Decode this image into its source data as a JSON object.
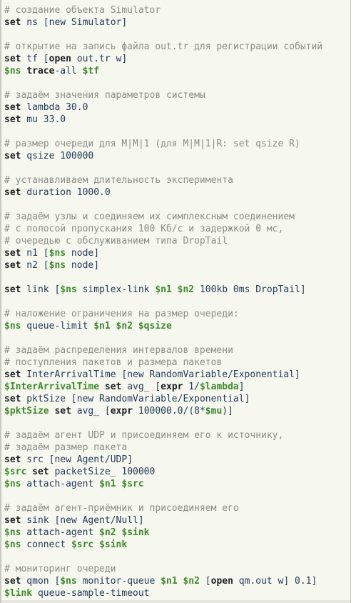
{
  "editor": {
    "lines": [
      [
        {
          "t": "c",
          "v": "# создание объекта Simulator"
        }
      ],
      [
        {
          "t": "k",
          "v": "set"
        },
        {
          "t": "x",
          "v": " ns [new Simulator]"
        }
      ],
      [],
      [
        {
          "t": "c",
          "v": "# открытие на запись файла out.tr для регистрации событий"
        }
      ],
      [
        {
          "t": "k",
          "v": "set"
        },
        {
          "t": "x",
          "v": " tf ["
        },
        {
          "t": "k",
          "v": "open"
        },
        {
          "t": "x",
          "v": " out.tr w]"
        }
      ],
      [
        {
          "t": "v",
          "v": "$ns"
        },
        {
          "t": "x",
          "v": " "
        },
        {
          "t": "k",
          "v": "trace"
        },
        {
          "t": "x",
          "v": "-all "
        },
        {
          "t": "v",
          "v": "$tf"
        }
      ],
      [],
      [
        {
          "t": "c",
          "v": "# задаём значения параметров системы"
        }
      ],
      [
        {
          "t": "k",
          "v": "set"
        },
        {
          "t": "x",
          "v": " lambda 30.0"
        }
      ],
      [
        {
          "t": "k",
          "v": "set"
        },
        {
          "t": "x",
          "v": " mu 33.0"
        }
      ],
      [],
      [
        {
          "t": "c",
          "v": "# размер очереди для M|M|1 (для M|M|1|R: set qsize R)"
        }
      ],
      [
        {
          "t": "k",
          "v": "set"
        },
        {
          "t": "x",
          "v": " qsize 100000"
        }
      ],
      [],
      [
        {
          "t": "c",
          "v": "# устанавливаем длительность эксперимента"
        }
      ],
      [
        {
          "t": "k",
          "v": "set"
        },
        {
          "t": "x",
          "v": " duration 1000.0"
        }
      ],
      [],
      [
        {
          "t": "c",
          "v": "# задаём узлы и соединяем их симплексным соединением"
        }
      ],
      [
        {
          "t": "c",
          "v": "# с полосой пропускания 100 Кб/с и задержкой 0 мс,"
        }
      ],
      [
        {
          "t": "c",
          "v": "# очередью с обслуживанием типа DropTail"
        }
      ],
      [
        {
          "t": "k",
          "v": "set"
        },
        {
          "t": "x",
          "v": " n1 ["
        },
        {
          "t": "v",
          "v": "$ns"
        },
        {
          "t": "x",
          "v": " node]"
        }
      ],
      [
        {
          "t": "k",
          "v": "set"
        },
        {
          "t": "x",
          "v": " n2 ["
        },
        {
          "t": "v",
          "v": "$ns"
        },
        {
          "t": "x",
          "v": " node]"
        }
      ],
      [],
      [
        {
          "t": "k",
          "v": "set"
        },
        {
          "t": "x",
          "v": " link ["
        },
        {
          "t": "v",
          "v": "$ns"
        },
        {
          "t": "x",
          "v": " simplex-link "
        },
        {
          "t": "v",
          "v": "$n1"
        },
        {
          "t": "x",
          "v": " "
        },
        {
          "t": "v",
          "v": "$n2"
        },
        {
          "t": "x",
          "v": " 100kb 0ms DropTail]"
        }
      ],
      [],
      [
        {
          "t": "c",
          "v": "# наложение ограничения на размер очереди:"
        }
      ],
      [
        {
          "t": "v",
          "v": "$ns"
        },
        {
          "t": "x",
          "v": " queue-limit "
        },
        {
          "t": "v",
          "v": "$n1"
        },
        {
          "t": "x",
          "v": " "
        },
        {
          "t": "v",
          "v": "$n2"
        },
        {
          "t": "x",
          "v": " "
        },
        {
          "t": "v",
          "v": "$qsize"
        }
      ],
      [],
      [
        {
          "t": "c",
          "v": "# задаём распределения интервалов времени"
        }
      ],
      [
        {
          "t": "c",
          "v": "# поступления пакетов и размера пакетов"
        }
      ],
      [
        {
          "t": "k",
          "v": "set"
        },
        {
          "t": "x",
          "v": " InterArrivalTime [new RandomVariable/Exponential]"
        }
      ],
      [
        {
          "t": "v",
          "v": "$InterArrivalTime"
        },
        {
          "t": "x",
          "v": " "
        },
        {
          "t": "k",
          "v": "set"
        },
        {
          "t": "x",
          "v": " avg_ ["
        },
        {
          "t": "k",
          "v": "expr"
        },
        {
          "t": "x",
          "v": " 1/"
        },
        {
          "t": "v",
          "v": "$lambda"
        },
        {
          "t": "x",
          "v": "]"
        }
      ],
      [
        {
          "t": "k",
          "v": "set"
        },
        {
          "t": "x",
          "v": " pktSize [new RandomVariable/Exponential]"
        }
      ],
      [
        {
          "t": "v",
          "v": "$pktSize"
        },
        {
          "t": "x",
          "v": " "
        },
        {
          "t": "k",
          "v": "set"
        },
        {
          "t": "x",
          "v": " avg_ ["
        },
        {
          "t": "k",
          "v": "expr"
        },
        {
          "t": "x",
          "v": " 100000.0/(8*"
        },
        {
          "t": "v",
          "v": "$mu"
        },
        {
          "t": "x",
          "v": ")]"
        }
      ],
      [],
      [
        {
          "t": "c",
          "v": "# задаём агент UDP и присоединяем его к источнику,"
        }
      ],
      [
        {
          "t": "c",
          "v": "# задаём размер пакета"
        }
      ],
      [
        {
          "t": "k",
          "v": "set"
        },
        {
          "t": "x",
          "v": " src [new Agent/UDP]"
        }
      ],
      [
        {
          "t": "v",
          "v": "$src"
        },
        {
          "t": "x",
          "v": " "
        },
        {
          "t": "k",
          "v": "set"
        },
        {
          "t": "x",
          "v": " packetSize_ 100000"
        }
      ],
      [
        {
          "t": "v",
          "v": "$ns"
        },
        {
          "t": "x",
          "v": " attach-agent "
        },
        {
          "t": "v",
          "v": "$n1"
        },
        {
          "t": "x",
          "v": " "
        },
        {
          "t": "v",
          "v": "$src"
        }
      ],
      [],
      [
        {
          "t": "c",
          "v": "# задаём агент-приёмник и присоединяем его"
        }
      ],
      [
        {
          "t": "k",
          "v": "set"
        },
        {
          "t": "x",
          "v": " sink [new Agent/Null]"
        }
      ],
      [
        {
          "t": "v",
          "v": "$ns"
        },
        {
          "t": "x",
          "v": " attach-agent "
        },
        {
          "t": "v",
          "v": "$n2"
        },
        {
          "t": "x",
          "v": " "
        },
        {
          "t": "v",
          "v": "$sink"
        }
      ],
      [
        {
          "t": "v",
          "v": "$ns"
        },
        {
          "t": "x",
          "v": " connect "
        },
        {
          "t": "v",
          "v": "$src"
        },
        {
          "t": "x",
          "v": " "
        },
        {
          "t": "v",
          "v": "$sink"
        }
      ],
      [],
      [
        {
          "t": "c",
          "v": "# мониторинг очереди"
        }
      ],
      [
        {
          "t": "k",
          "v": "set"
        },
        {
          "t": "x",
          "v": " qmon ["
        },
        {
          "t": "v",
          "v": "$ns"
        },
        {
          "t": "x",
          "v": " monitor-queue "
        },
        {
          "t": "v",
          "v": "$n1"
        },
        {
          "t": "x",
          "v": " "
        },
        {
          "t": "v",
          "v": "$n2"
        },
        {
          "t": "x",
          "v": " ["
        },
        {
          "t": "k",
          "v": "open"
        },
        {
          "t": "x",
          "v": " qm.out w] 0.1]"
        }
      ],
      [
        {
          "t": "v",
          "v": "$link"
        },
        {
          "t": "x",
          "v": " queue-sample-timeout"
        }
      ]
    ]
  },
  "colors": {
    "background": "#f6f7ef",
    "comment": "#8a8d87",
    "keyword": "#1d1f22",
    "variable": "#3f8a2e",
    "text": "#243b5a"
  }
}
